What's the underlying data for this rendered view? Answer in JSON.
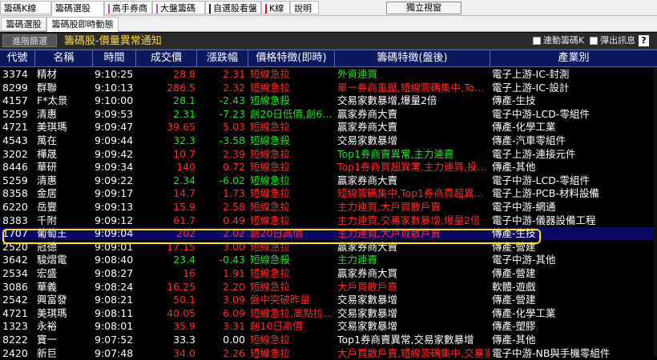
{
  "top_tabs": [
    {
      "label": "籌碼K線",
      "mark": ""
    },
    {
      "label": "籌碼選股",
      "mark": "",
      "active": true
    },
    {
      "label": "高手券商",
      "mark": "#e63ad8"
    },
    {
      "label": "大盤籌碼",
      "mark": "#b84fd6"
    },
    {
      "label": "自選股看盤",
      "mark": "#222222"
    },
    {
      "label": "K線",
      "mark": "#e01010"
    },
    {
      "label": "說明",
      "mark": ""
    }
  ],
  "float_window_button": "獨立視窗",
  "sub_tabs": [
    {
      "label": "籌碼選股"
    },
    {
      "label": "籌碼股即時動態",
      "active": true
    }
  ],
  "toolbar": {
    "advanced_button": "進階篩選",
    "title": "籌碼股-價量異常通知",
    "link_kline": "連動籌碼K",
    "popup_msg": "彈出訊息",
    "help": "?"
  },
  "columns": [
    "代號",
    "名稱",
    "時間",
    "成交價",
    "漲跌幅",
    "價格特徵(即時)",
    "籌碼特徵(盤後)",
    "產業別"
  ],
  "rows": [
    {
      "code": "3374",
      "name": "精材",
      "time": "9:10:25",
      "price": "28.8",
      "chg": "2.31",
      "f1": "短線急拉",
      "f2": "外資連買",
      "ind": "電子上游-IC-封測",
      "pc": "red",
      "f1c": "red",
      "f2c": "green"
    },
    {
      "code": "8299",
      "name": "群聯",
      "time": "9:10:13",
      "price": "286.5",
      "chg": "2.32",
      "f1": "短線急拉",
      "f2": "單一券商重壓,短線籌碼集中,To...",
      "ind": "電子上游-IC-設計",
      "pc": "red",
      "f1c": "red",
      "f2c": "red"
    },
    {
      "code": "4157",
      "name": "F*太景",
      "time": "9:10:00",
      "price": "28.1",
      "chg": "-2.43",
      "f1": "短線急殺",
      "f2": "交易家數暴增,爆量2倍",
      "ind": "傳產-生技",
      "pc": "green",
      "f1c": "green",
      "f2c": "white"
    },
    {
      "code": "5259",
      "name": "清惠",
      "time": "9:09:53",
      "price": "2.31",
      "chg": "-7.23",
      "f1": "創20日低價,創6...",
      "f2": "贏家券商大賣",
      "ind": "電子中游-LCD-零組件",
      "pc": "green",
      "f1c": "green",
      "f2c": "white"
    },
    {
      "code": "4721",
      "name": "美琪瑪",
      "time": "9:09:47",
      "price": "39.65",
      "chg": "5.03",
      "f1": "短線急拉",
      "f2": "贏家券商大賣",
      "ind": "傳產-化學工業",
      "pc": "red",
      "f1c": "red",
      "f2c": "white"
    },
    {
      "code": "4543",
      "name": "萬在",
      "time": "9:09:44",
      "price": "32.3",
      "chg": "-3.58",
      "f1": "短線急殺",
      "f2": "交易家數暴增",
      "ind": "傳產-汽車零組件",
      "pc": "green",
      "f1c": "green",
      "f2c": "white"
    },
    {
      "code": "3202",
      "name": "樺晟",
      "time": "9:09:42",
      "price": "10.7",
      "chg": "2.39",
      "f1": "短線急拉",
      "f2": "Top1券商賣異常,主力連賣",
      "ind": "電子上游-連接元件",
      "pc": "red",
      "f1c": "red",
      "f2c": "green"
    },
    {
      "code": "8446",
      "name": "華研",
      "time": "9:09:34",
      "price": "140",
      "chg": "0.72",
      "f1": "短線急拉",
      "f2": "Top1券商買超異常,主力連買,投...",
      "ind": "傳產-其他",
      "pc": "red",
      "f1c": "red",
      "f2c": "red"
    },
    {
      "code": "5259",
      "name": "清惠",
      "time": "9:09:22",
      "price": "2.34",
      "chg": "-6.02",
      "f1": "短線急拉",
      "f2": "贏家券商大賣",
      "ind": "電子中游-LCD-零組件",
      "pc": "green",
      "f1c": "green",
      "f2c": "white"
    },
    {
      "code": "8358",
      "name": "金居",
      "time": "9:09:17",
      "price": "14.7",
      "chg": "1.73",
      "f1": "短線急拉",
      "f2": "短線籌碼集中,Top1券商買超異...",
      "ind": "電子上游-PCB-材料設備",
      "pc": "red",
      "f1c": "red",
      "f2c": "red"
    },
    {
      "code": "6220",
      "name": "岳豐",
      "time": "9:09:13",
      "price": "15.9",
      "chg": "2.58",
      "f1": "短線急拉",
      "f2": "主力連買,大戶買散戶賣",
      "ind": "電子中游-網通",
      "pc": "red",
      "f1c": "red",
      "f2c": "red"
    },
    {
      "code": "8383",
      "name": "千附",
      "time": "9:09:12",
      "price": "61.7",
      "chg": "0.49",
      "f1": "短線急拉",
      "f2": "主力連買,交易家數暴增,爆量2倍",
      "ind": "電子中游-儀器設備工程",
      "pc": "red",
      "f1c": "red",
      "f2c": "red"
    },
    {
      "code": "1707",
      "name": "葡萄王",
      "time": "9:09:04",
      "price": "202",
      "chg": "2.02",
      "f1": "創20日高價",
      "f2": "主力連買,大戶買散戶賣",
      "ind": "傳產-生技",
      "pc": "red",
      "f1c": "red",
      "f2c": "red",
      "selected": true
    },
    {
      "code": "2520",
      "name": "冠德",
      "time": "9:09:01",
      "price": "17.15",
      "chg": "3.00",
      "f1": "短線急拉",
      "f2": "贏家券商大賣",
      "ind": "傳產-營建",
      "pc": "red",
      "f1c": "red",
      "f2c": "white"
    },
    {
      "code": "3642",
      "name": "駿熠電",
      "time": "9:08:40",
      "price": "23.4",
      "chg": "-0.43",
      "f1": "短線急殺",
      "f2": "主力連賣",
      "ind": "電子中游-其他",
      "pc": "green",
      "f1c": "green",
      "f2c": "green"
    },
    {
      "code": "2534",
      "name": "宏盛",
      "time": "9:08:27",
      "price": "16",
      "chg": "1.91",
      "f1": "短線急拉",
      "f2": "贏家券商大買",
      "ind": "傳產-營建",
      "pc": "red",
      "f1c": "red",
      "f2c": "white"
    },
    {
      "code": "3086",
      "name": "華義",
      "time": "9:08:24",
      "price": "16.25",
      "chg": "2.20",
      "f1": "短線急拉",
      "f2": "大戶買散戶賣",
      "ind": "軟體-遊戲",
      "pc": "red",
      "f1c": "red",
      "f2c": "red"
    },
    {
      "code": "2542",
      "name": "興富發",
      "time": "9:08:21",
      "price": "50.1",
      "chg": "3.09",
      "f1": "盤中突破昨量",
      "f2": "交易家數暴增",
      "ind": "傳產-營建",
      "pc": "red",
      "f1c": "red",
      "f2c": "white"
    },
    {
      "code": "4721",
      "name": "美琪瑪",
      "time": "9:08:11",
      "price": "40.05",
      "chg": "6.09",
      "f1": "短線急拉,高點拉...",
      "f2": "交易家數暴增",
      "ind": "傳產-化學工業",
      "pc": "red",
      "f1c": "red",
      "f2c": "white"
    },
    {
      "code": "1323",
      "name": "永裕",
      "time": "9:08:01",
      "price": "35.9",
      "chg": "3.31",
      "f1": "創10日高價",
      "f2": "交易家數暴增",
      "ind": "傳產-塑膠",
      "pc": "red",
      "f1c": "red",
      "f2c": "white"
    },
    {
      "code": "8222",
      "name": "寶一",
      "time": "9:07:52",
      "price": "33.3",
      "chg": "0.00",
      "f1": "短線急拉",
      "f2": "Top1券商賣異常,交易家數暴增",
      "ind": "傳產-其他",
      "pc": "white",
      "f1c": "red",
      "f2c": "white"
    },
    {
      "code": "2420",
      "name": "新巨",
      "time": "9:07:48",
      "price": "34.0",
      "chg": "2.26",
      "f1": "短線急拉",
      "f2": "大戶買散戶賣,短線籌碼集中,交易家",
      "ind": "電子中游-NB與手機零組件",
      "pc": "red",
      "f1c": "red",
      "f2c": "red"
    }
  ]
}
